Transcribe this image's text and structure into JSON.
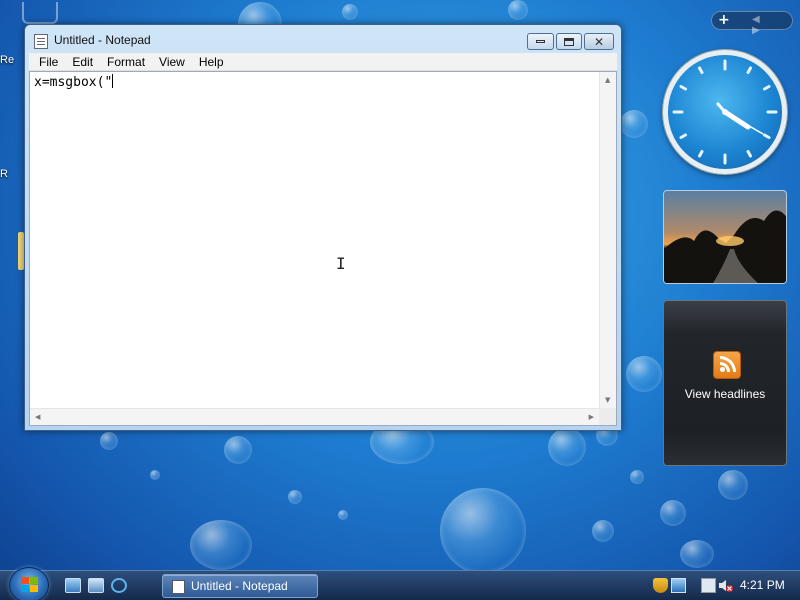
{
  "desktop": {
    "stub_labels": [
      "Re",
      "R"
    ]
  },
  "notepad": {
    "title": "Untitled - Notepad",
    "menu": [
      "File",
      "Edit",
      "Format",
      "View",
      "Help"
    ],
    "content": "x=msgbox(\"",
    "icons": {
      "app": "notepad-icon",
      "minimize": "minimize-icon",
      "maximize": "maximize-icon",
      "close": "close-icon"
    }
  },
  "gadgets": {
    "add_label": "+",
    "nav_arrows": "◀ ▶",
    "clock_time": "4:21",
    "feed_label": "View headlines"
  },
  "taskbar": {
    "task_label": "Untitled - Notepad",
    "time": "4:21 PM",
    "quick_launch": [
      "show-desktop-icon",
      "switch-windows-icon",
      "internet-explorer-icon"
    ],
    "tray_icons": [
      "shield-icon",
      "network-icon",
      "volume-muted-icon"
    ]
  },
  "colors": {
    "desktop_blue": "#1e7cd0",
    "taskbar": "#14294a",
    "rss_orange": "#e47a14"
  }
}
